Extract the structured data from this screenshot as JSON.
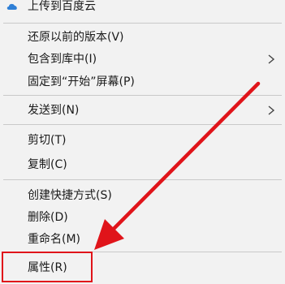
{
  "menu": {
    "items": [
      {
        "label": "上传到百度云",
        "has_submenu": false
      },
      {
        "label": "还原以前的版本(V)",
        "has_submenu": false
      },
      {
        "label": "包含到库中(I)",
        "has_submenu": true
      },
      {
        "label": "固定到“开始”屏幕(P)",
        "has_submenu": false
      },
      {
        "label": "发送到(N)",
        "has_submenu": true
      },
      {
        "label": "剪切(T)",
        "has_submenu": false
      },
      {
        "label": "复制(C)",
        "has_submenu": false
      },
      {
        "label": "创建快捷方式(S)",
        "has_submenu": false
      },
      {
        "label": "删除(D)",
        "has_submenu": false
      },
      {
        "label": "重命名(M)",
        "has_submenu": false
      },
      {
        "label": "属性(R)",
        "has_submenu": false
      }
    ]
  },
  "colors": {
    "menu_background": "#f2f2f2",
    "annotation_red": "#e0141a",
    "separator": "#c9c9c9",
    "cloud_icon_blue": "#2f7fd6"
  },
  "icons": {
    "first_item": "baidu-cloud-icon",
    "submenu": "chevron-right-icon"
  }
}
